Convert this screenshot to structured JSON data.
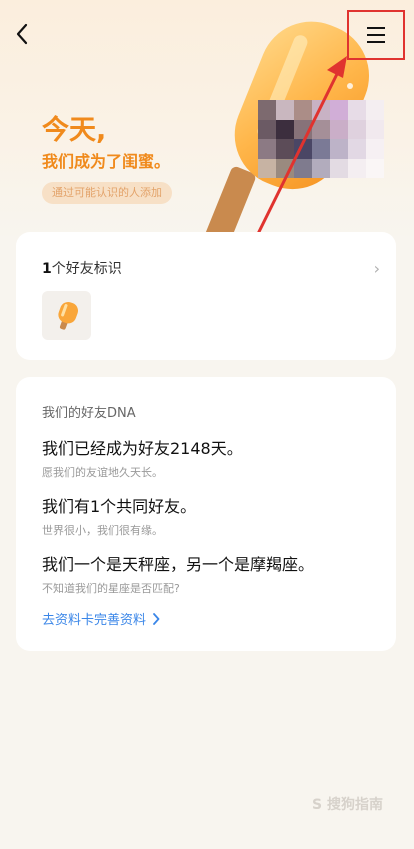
{
  "hero": {
    "title": "今天,",
    "subtitle": "我们成为了闺蜜。",
    "tag": "通过可能认识的人添加"
  },
  "nav": {
    "back_icon": "back-arrow-icon",
    "menu_icon": "menu-icon"
  },
  "badges": {
    "count": "1",
    "label": "个好友标识",
    "icon": "popsicle-badge-icon"
  },
  "dna": {
    "title": "我们的好友DNA",
    "facts": [
      {
        "main": "我们已经成为好友2148天。",
        "sub": "愿我们的友谊地久天长。"
      },
      {
        "main": "我们有1个共同好友。",
        "sub": "世界很小，我们很有缘。"
      },
      {
        "main": "我们一个是天秤座，另一个是摩羯座。",
        "sub": "不知道我们的星座是否匹配?"
      }
    ],
    "link": "去资料卡完善资料"
  },
  "watermark": "S 搜狗指南",
  "colors": {
    "accent_orange": "#f08a1c",
    "link_blue": "#3a86e8",
    "annotation_red": "#e0332f"
  }
}
